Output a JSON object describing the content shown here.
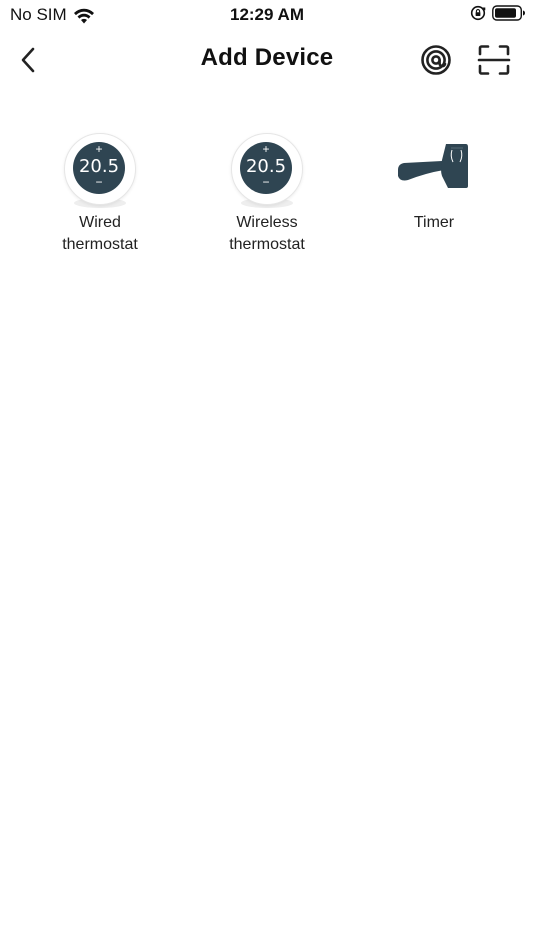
{
  "status_bar": {
    "carrier": "No SIM",
    "time": "12:29 AM",
    "icons": [
      "wifi-icon",
      "rotation-lock-icon",
      "battery-icon"
    ]
  },
  "nav": {
    "title": "Add Device",
    "back_icon": "chevron-left-icon",
    "nearby_icon": "at-sign-icon",
    "scan_icon": "scan-frame-icon"
  },
  "devices": [
    {
      "label": "Wired\nthermostat",
      "icon": "thermostat-icon",
      "display": {
        "plus": "+",
        "reading": "20.5",
        "minus": "−"
      }
    },
    {
      "label": "Wireless\nthermostat",
      "icon": "thermostat-icon",
      "display": {
        "plus": "+",
        "reading": "20.5",
        "minus": "−"
      }
    },
    {
      "label": "Timer",
      "icon": "faucet-icon"
    }
  ],
  "colors": {
    "device_dark": "#2f4552",
    "text": "#111111",
    "background": "#ffffff"
  }
}
